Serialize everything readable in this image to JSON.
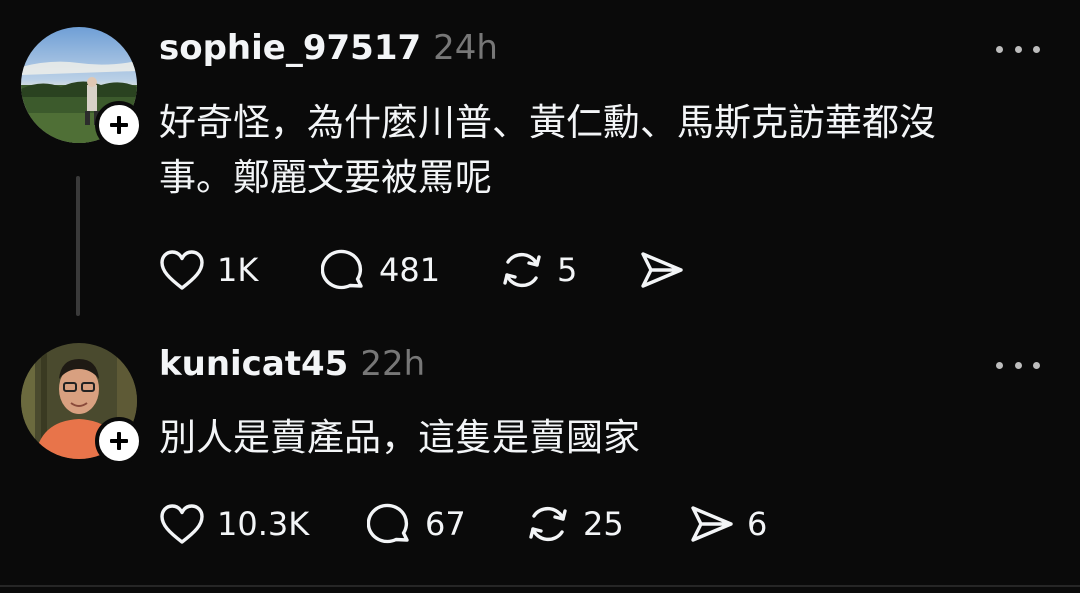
{
  "posts": [
    {
      "username": "sophie_97517",
      "time": "24h",
      "avatar": "landscape-with-person-avatar",
      "text": "好奇怪，為什麼川普、黃仁勳、馬斯克訪華都沒\n事。鄭麗文要被罵呢",
      "likes": "1K",
      "replies": "481",
      "reposts": "5",
      "shares": ""
    },
    {
      "username": "kunicat45",
      "time": "22h",
      "avatar": "man-with-glasses-avatar",
      "text": "別人是賣產品，這隻是賣國家",
      "likes": "10.3K",
      "replies": "67",
      "reposts": "25",
      "shares": "6"
    }
  ],
  "icons": {
    "like": "heart-icon",
    "reply": "comment-bubble-icon",
    "repost": "repost-arrows-icon",
    "share": "send-icon",
    "more": "more-horizontal-icon",
    "follow": "plus-icon"
  },
  "colors": {
    "background": "#0a0a0a",
    "text": "#f3f5f7",
    "secondary": "#777777",
    "thread_line": "#3a3a3a"
  }
}
